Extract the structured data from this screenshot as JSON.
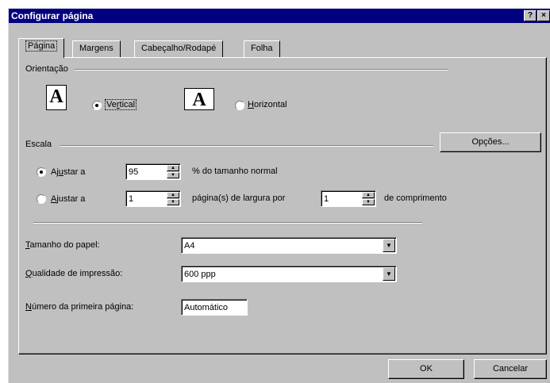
{
  "window": {
    "title": "Configurar página",
    "help_glyph": "?",
    "close_glyph": "×"
  },
  "tabs": [
    {
      "label": "Página",
      "active": true
    },
    {
      "label": "Margens",
      "active": false
    },
    {
      "label": "Cabeçalho/Rodapé",
      "active": false
    },
    {
      "label": "Folha",
      "active": false
    }
  ],
  "orientation": {
    "group_label": "Orientação",
    "portrait": {
      "icon_letter": "A",
      "label_pre": "Ve",
      "label_u": "r",
      "label_post": "tical",
      "checked": true
    },
    "landscape": {
      "icon_letter": "A",
      "label_pre": "",
      "label_u": "H",
      "label_post": "orizontal",
      "checked": false
    }
  },
  "scale": {
    "group_label": "Escala",
    "options_button": "Opções...",
    "adjust_percent": {
      "label_pre": "Aj",
      "label_u": "u",
      "label_post": "star a",
      "value": "95",
      "suffix": "% do tamanho normal",
      "checked": true
    },
    "fit_to": {
      "label_pre": "",
      "label_u": "A",
      "label_post": "justar a",
      "pages_wide": "1",
      "middle": "página(s) de largura por",
      "pages_tall": "1",
      "suffix": "de comprimento",
      "checked": false
    }
  },
  "paper": {
    "size_label_u": "T",
    "size_label_post": "amanho do papel:",
    "size_value": "A4",
    "quality_label_u": "Q",
    "quality_label_post": "ualidade de impressão:",
    "quality_value": "600 ppp",
    "first_page_label_u": "N",
    "first_page_label_post": "úmero da primeira página:",
    "first_page_value": "Automático"
  },
  "footer": {
    "ok": "OK",
    "cancel": "Cancelar"
  }
}
